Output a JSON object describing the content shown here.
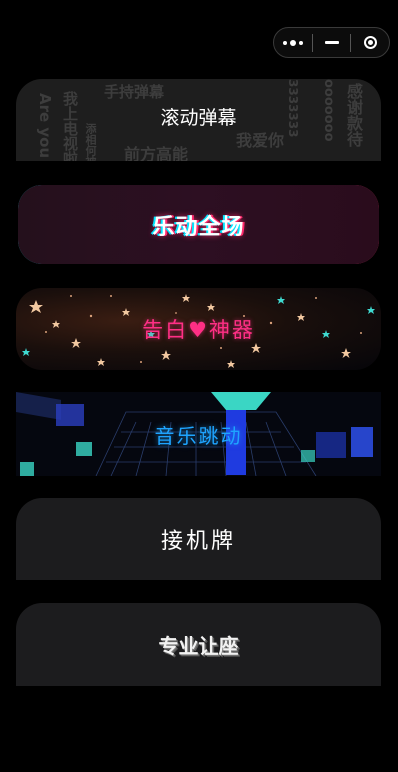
{
  "capsule": {
    "more_icon": "more-dots-icon",
    "minimize_icon": "minimize-icon",
    "close_icon": "target-icon"
  },
  "cards": [
    {
      "title": "滚动弹幕",
      "bg_texts": [
        "手持弹幕",
        "我上电视啦",
        "前方高能",
        "我爱你",
        "Are you",
        "感谢款待",
        "ooooooo",
        "3333333",
        "添相何被"
      ]
    },
    {
      "title": "乐动全场"
    },
    {
      "title_a": "告白",
      "heart": "♥",
      "title_b": "神器"
    },
    {
      "title": "音乐跳动"
    },
    {
      "title": "接机牌"
    },
    {
      "title": "专业让座"
    }
  ],
  "colors": {
    "background": "#000000",
    "card": "#1c1c1e",
    "neon_cyan": "#2fd1e6",
    "neon_pink": "#ff2a6d",
    "confession_pink": "#ff2f85",
    "music_blue": "#1ea4ff"
  }
}
